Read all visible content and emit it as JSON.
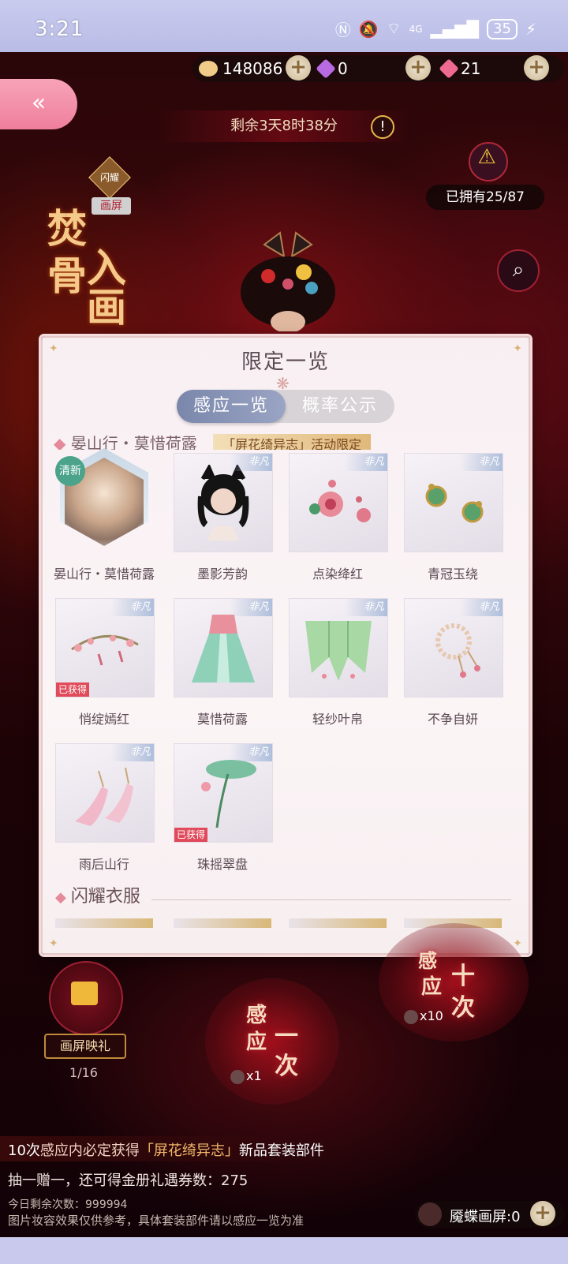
{
  "status": {
    "time": "3:21",
    "battery": "35",
    "network": "4G"
  },
  "currency": {
    "coins": "148086",
    "diamonds": "0",
    "pink_gems": "21"
  },
  "event": {
    "timer": "剩余3天8时38分",
    "owned": "已拥有25/87",
    "badge_shine": "闪耀",
    "badge_screen": "画屏",
    "title_chars": [
      "焚",
      "骨",
      "入",
      "画"
    ]
  },
  "modal": {
    "title": "限定一览",
    "tabs": {
      "active": "感应一览",
      "inactive": "概率公示"
    },
    "section1_head": "晏山行・莫惜荷露",
    "section1_tag": "「屏花绮异志」活动限定",
    "item_tag": "非凡",
    "got_label": "已获得",
    "new_label": "清新",
    "items": [
      {
        "label": "晏山行・莫惜荷露"
      },
      {
        "label": "墨影芳韵"
      },
      {
        "label": "点染绛红"
      },
      {
        "label": "青冠玉绕"
      },
      {
        "label": "悄绽嫣红"
      },
      {
        "label": "莫惜荷露"
      },
      {
        "label": "轻纱叶帛"
      },
      {
        "label": "不争自妍"
      },
      {
        "label": "雨后山行"
      },
      {
        "label": "珠摇翠盘"
      }
    ],
    "section2_title": "闪耀衣服"
  },
  "gift": {
    "label": "画屏映礼",
    "count": "1/16"
  },
  "draw": {
    "once_label": [
      "感",
      "应",
      "一",
      "次"
    ],
    "once_cost": "x1",
    "ten_label": [
      "感",
      "应",
      "十",
      "次"
    ],
    "ten_cost": "x10"
  },
  "notes": {
    "line1_prefix": "10次",
    "line1_mid": "感应内必定获得",
    "line1_hl": "「屏花绮异志」",
    "line1_suffix": "新品套装部件",
    "line2": "抽一赠一，还可得金册礼遇券数：275",
    "line3": "今日剩余次数：999994",
    "line4": "图片妆容效果仅供参考，具体套装部件请以感应一览为准"
  },
  "magic": {
    "label": "魇蝶画屏:0"
  },
  "colors": {
    "accent_pink": "#ef7f9c",
    "tab_active": "#7a87ab",
    "got_red": "#e04a5a",
    "highlight": "#f3b76a"
  }
}
